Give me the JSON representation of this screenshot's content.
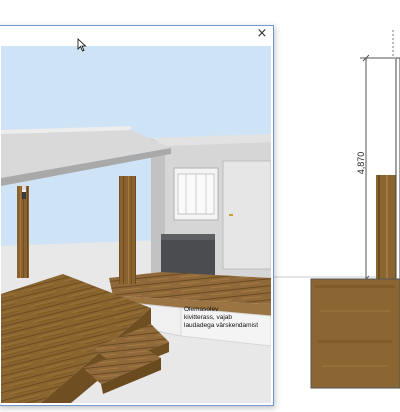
{
  "window": {
    "close_glyph": "×"
  },
  "scene": {
    "annotation_lines": [
      "Olemasolev",
      "kivitterass, vajab",
      "laudadega värskendamist"
    ]
  },
  "cad": {
    "dimension_label": "4,870"
  },
  "colors": {
    "sky": "#cfe3f7",
    "ground": "#e6e6e6",
    "wood": "#8a6530",
    "wall": "#d4d4d4",
    "window_border": "#6f9bcf"
  },
  "icons": [
    "close-icon",
    "mouse-pointer-icon"
  ]
}
